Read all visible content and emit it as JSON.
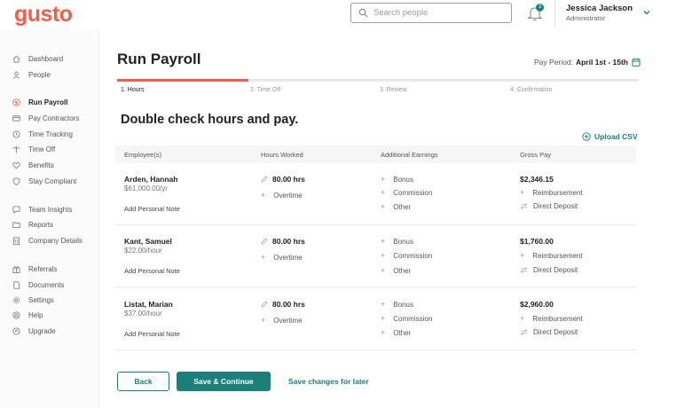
{
  "app": {
    "logo": "gusto"
  },
  "header": {
    "search_placeholder": "Search people",
    "notification_count": "3",
    "user_name": "Jessica Jackson",
    "user_role": "Administrator"
  },
  "sidebar": {
    "items": [
      {
        "label": "Dashboard",
        "icon": "home-icon"
      },
      {
        "label": "People",
        "icon": "person-icon"
      },
      {
        "label": "Run Payroll",
        "icon": "dollar-icon",
        "active": true
      },
      {
        "label": "Pay Contractors",
        "icon": "card-icon"
      },
      {
        "label": "Time Tracking",
        "icon": "clock-icon"
      },
      {
        "label": "Time Off",
        "icon": "palm-icon"
      },
      {
        "label": "Benefits",
        "icon": "heart-icon"
      },
      {
        "label": "Stay Compliant",
        "icon": "shield-icon"
      },
      {
        "label": "Team Insights",
        "icon": "chat-icon"
      },
      {
        "label": "Reports",
        "icon": "folder-icon"
      },
      {
        "label": "Company Details",
        "icon": "building-icon"
      },
      {
        "label": "Referrals",
        "icon": "gift-icon"
      },
      {
        "label": "Documents",
        "icon": "document-icon"
      },
      {
        "label": "Settings",
        "icon": "gear-icon"
      },
      {
        "label": "Help",
        "icon": "help-icon"
      },
      {
        "label": "Upgrade",
        "icon": "upgrade-icon"
      }
    ]
  },
  "page": {
    "title": "Run Payroll",
    "pay_period_label": "Pay Period:",
    "pay_period_value": "April 1st - 15th",
    "steps": [
      "1. Hours",
      "2. Time Off",
      "3. Review",
      "4. Confirmation"
    ],
    "section_title": "Double check hours and pay.",
    "upload_label": "Upload CSV"
  },
  "table": {
    "headers": [
      "Employee(s)",
      "Hours Worked",
      "Additional Earnings",
      "Gross Pay"
    ],
    "rows": [
      {
        "name": "Arden, Hannah",
        "rate": "$61,000.00/yr",
        "note": "Add Personal Note",
        "hours": "80.00 hrs",
        "overtime": "Overtime",
        "earnings": [
          "Bonus",
          "Commission",
          "Other"
        ],
        "gross": "$2,346.15",
        "reimbursement": "Reimbursement",
        "deposit": "Direct Deposit"
      },
      {
        "name": "Kant, Samuel",
        "rate": "$22.00/hour",
        "note": "Add Personal Note",
        "hours": "80.00 hrs",
        "overtime": "Overtime",
        "earnings": [
          "Bonus",
          "Commission",
          "Other"
        ],
        "gross": "$1,760.00",
        "reimbursement": "Reimbursement",
        "deposit": "Direct Deposit"
      },
      {
        "name": "Listat, Marian",
        "rate": "$37.00/hour",
        "note": "Add Personal Note",
        "hours": "80.00 hrs",
        "overtime": "Overtime",
        "earnings": [
          "Bonus",
          "Commission",
          "Other"
        ],
        "gross": "$2,960.00",
        "reimbursement": "Reimbursement",
        "deposit": "Direct Deposit"
      }
    ]
  },
  "footer": {
    "back_label": "Back",
    "save_label": "Save & Continue",
    "later_label": "Save changes for later"
  },
  "colors": {
    "brand": "#f45d48",
    "accent": "#1b7f7a"
  }
}
